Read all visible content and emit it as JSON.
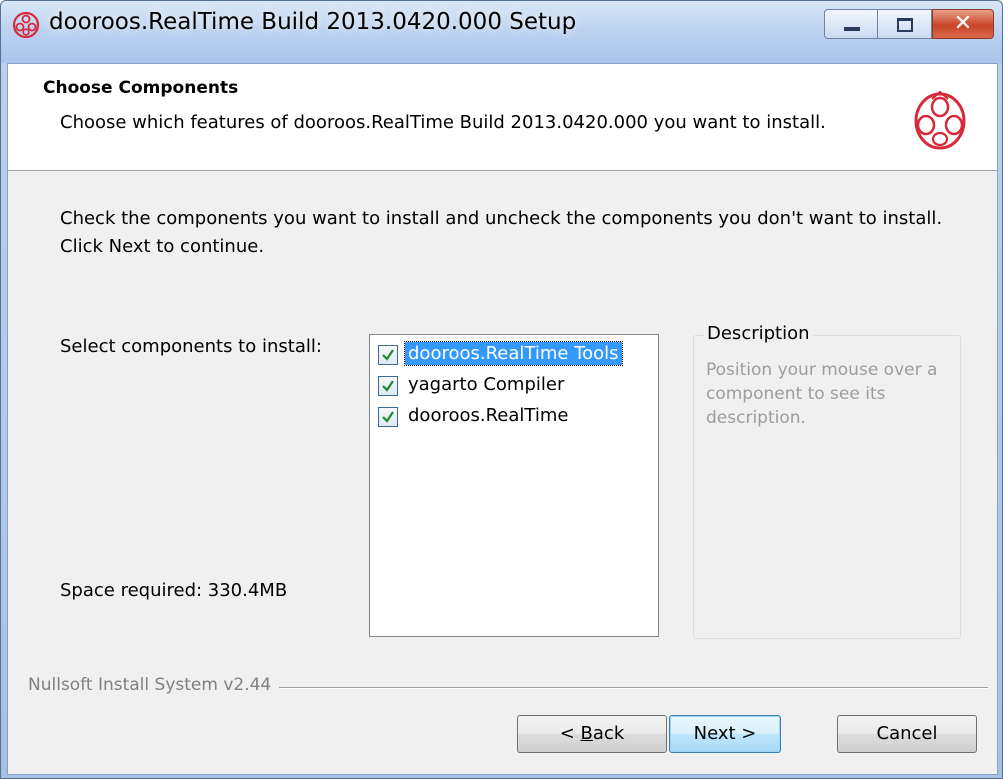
{
  "window": {
    "title": "dooroos.RealTime Build 2013.0420.000 Setup",
    "icon": "dooroos-logo-icon",
    "caption_buttons": [
      "minimize-icon",
      "maximize-icon",
      "close-icon"
    ]
  },
  "header": {
    "title": "Choose Components",
    "subtitle": "Choose which features of dooroos.RealTime Build 2013.0420.000 you want to install."
  },
  "body": {
    "instructions": "Check the components you want to install and uncheck the components you don't want to install. Click Next to continue.",
    "select_label": "Select components to install:",
    "space_required": "Space required: 330.4MB"
  },
  "components": [
    {
      "label": "dooroos.RealTime Tools",
      "checked": true,
      "selected": true
    },
    {
      "label": "yagarto Compiler",
      "checked": true,
      "selected": false
    },
    {
      "label": "dooroos.RealTime",
      "checked": true,
      "selected": false
    }
  ],
  "description": {
    "legend": "Description",
    "text": "Position your mouse over a component to see its description."
  },
  "footer": {
    "branding": "Nullsoft Install System v2.44"
  },
  "buttons": {
    "back_prefix": "< ",
    "back_accel": "B",
    "back_rest": "ack",
    "next": "Next >",
    "cancel": "Cancel"
  },
  "colors": {
    "accent_logo": "#d8283a",
    "selection": "#3399ff",
    "check": "#1e8a2e"
  }
}
